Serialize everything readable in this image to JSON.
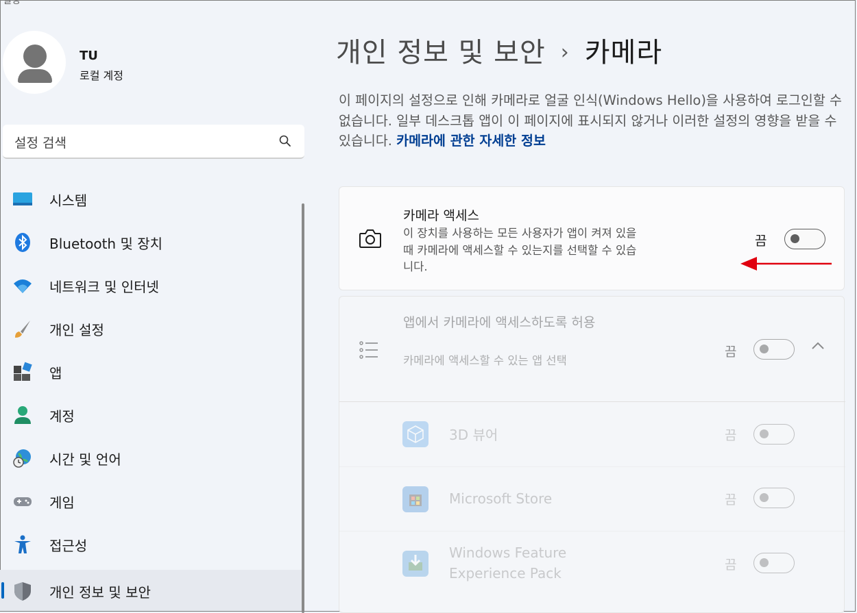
{
  "window": {
    "title_fragment": "설정"
  },
  "profile": {
    "name": "TU",
    "account_type": "로컬 계정"
  },
  "search": {
    "placeholder": "설정 검색"
  },
  "nav": {
    "items": [
      {
        "label": "시스템",
        "icon": "system-icon"
      },
      {
        "label": "Bluetooth 및 장치",
        "icon": "bluetooth-icon"
      },
      {
        "label": "네트워크 및 인터넷",
        "icon": "wifi-icon"
      },
      {
        "label": "개인 설정",
        "icon": "brush-icon"
      },
      {
        "label": "앱",
        "icon": "apps-icon"
      },
      {
        "label": "계정",
        "icon": "account-icon"
      },
      {
        "label": "시간 및 언어",
        "icon": "globe-clock-icon"
      },
      {
        "label": "게임",
        "icon": "gamepad-icon"
      },
      {
        "label": "접근성",
        "icon": "accessibility-icon"
      },
      {
        "label": "개인 정보 및 보안",
        "icon": "shield-icon",
        "selected": true
      }
    ]
  },
  "breadcrumb": {
    "parent": "개인 정보 및 보안",
    "separator": "›",
    "current": "카메라"
  },
  "description": {
    "text": "이 페이지의 설정으로 인해 카메라로 얼굴 인식(Windows Hello)을 사용하여 로그인할 수 없습니다. 일부 데스크톱 앱이 이 페이지에 표시되지 않거나 이러한 설정의 영향을 받을 수 있습니다.",
    "link": "카메라에 관한 자세한 정보"
  },
  "camera_access": {
    "title": "카메라 액세스",
    "subtitle": "이 장치를 사용하는 모든 사용자가 앱이 켜져 있을 때 카메라에 액세스할 수 있는지를 선택할 수 있습니다.",
    "state_label": "끔",
    "on": false
  },
  "app_access": {
    "title": "앱에서 카메라에 액세스하도록 허용",
    "subtitle": "카메라에 액세스할 수 있는 앱 선택",
    "state_label": "끔",
    "on": false,
    "expanded": true
  },
  "apps": [
    {
      "name": "3D 뷰어",
      "state_label": "끔",
      "icon": "cube-icon"
    },
    {
      "name": "Microsoft Store",
      "state_label": "끔",
      "icon": "store-icon"
    },
    {
      "name": "Windows Feature Experience Pack",
      "state_label": "끔",
      "icon": "download-box-icon"
    }
  ],
  "colors": {
    "accent": "#0067c0",
    "link": "#003e92",
    "annotation_arrow": "#e0000f"
  }
}
